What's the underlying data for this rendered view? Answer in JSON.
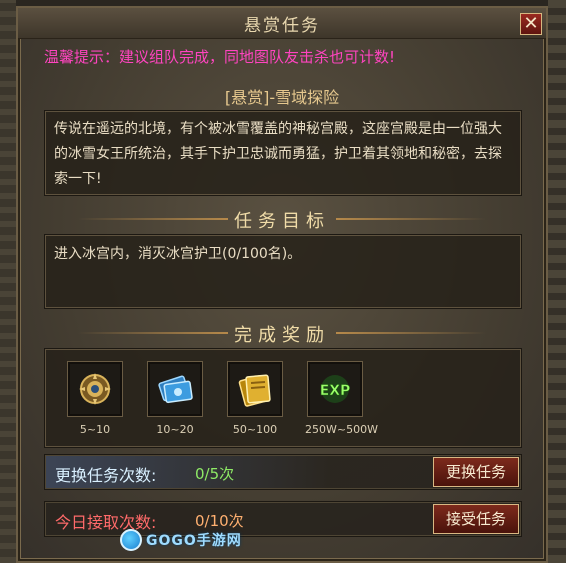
{
  "window": {
    "title": "悬赏任务",
    "close_label": "✕"
  },
  "tip": "温馨提示：建议组队完成，同地图队友击杀也可计数!",
  "quest": {
    "name": "[悬赏]-雪域探险",
    "description": "传说在遥远的北境，有个被冰雪覆盖的神秘宫殿，这座宫殿是由一位强大的冰雪女王所统治，其手下护卫忠诚而勇猛，护卫着其领地和秘密，去探索一下!"
  },
  "sections": {
    "goal": "任务目标",
    "reward": "完成奖励"
  },
  "goal_text": "进入冰宫内，消灭冰宫护卫(0/100名)。",
  "rewards": [
    {
      "icon": "gold-coin-icon",
      "amount": "5~10"
    },
    {
      "icon": "blue-ticket-icon",
      "amount": "10~20"
    },
    {
      "icon": "gold-ticket-icon",
      "amount": "50~100"
    },
    {
      "icon": "exp-icon",
      "amount": "250W~500W",
      "icon_text": "EXP"
    }
  ],
  "refresh": {
    "label": "更换任务次数:",
    "value": "0/5次",
    "button": "更换任务"
  },
  "accept": {
    "label": "今日接取次数:",
    "value": "0/10次",
    "button": "接受任务"
  },
  "watermark": "GOGO手游网",
  "colors": {
    "tip": "#ff44c0",
    "title": "#ead9b0",
    "refresh_value": "#8eea66",
    "accept_label": "#ff6a6a",
    "button_bg": "#7d2a1c"
  }
}
